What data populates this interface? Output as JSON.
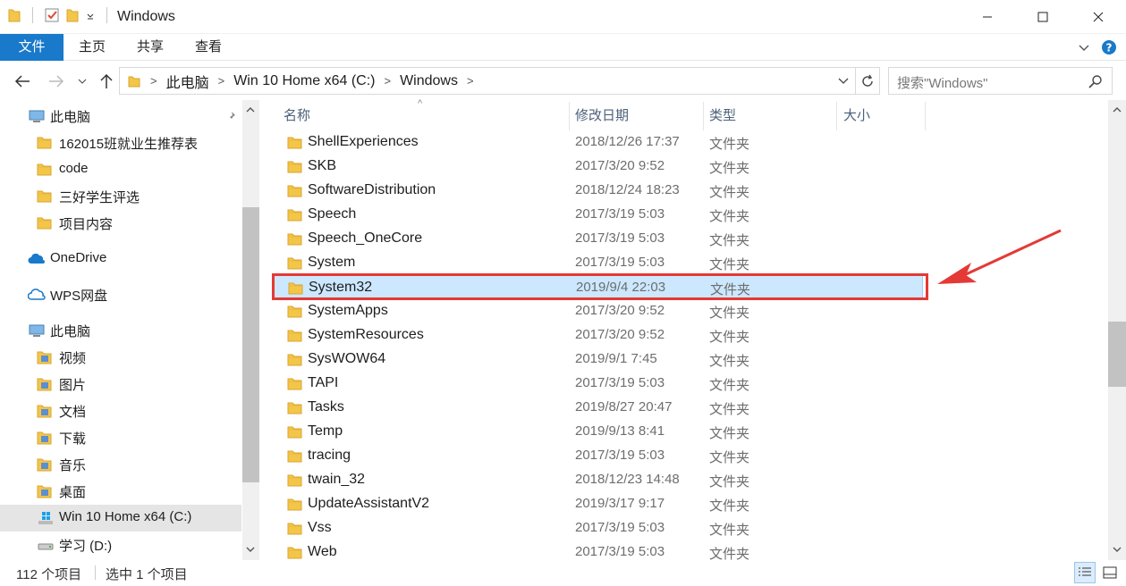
{
  "window": {
    "title": "Windows"
  },
  "ribbon": {
    "tabs": [
      "文件",
      "主页",
      "共享",
      "查看"
    ]
  },
  "address": {
    "crumbs": [
      "此电脑",
      "Win 10 Home x64 (C:)",
      "Windows"
    ]
  },
  "search": {
    "placeholder": "搜索\"Windows\""
  },
  "sidebar": {
    "items": [
      {
        "label": "此电脑",
        "icon": "pc-icon",
        "indent": 1,
        "pinned": true
      },
      {
        "label": "162015班就业生推荐表",
        "icon": "folder-icon",
        "indent": 2
      },
      {
        "label": "code",
        "icon": "folder-icon",
        "indent": 2
      },
      {
        "label": "三好学生评选",
        "icon": "folder-icon",
        "indent": 2
      },
      {
        "label": "项目内容",
        "icon": "folder-icon",
        "indent": 2
      },
      {
        "label": "OneDrive",
        "icon": "onedrive-icon",
        "indent": 1
      },
      {
        "label": "WPS网盘",
        "icon": "cloud-icon",
        "indent": 1
      },
      {
        "label": "此电脑",
        "icon": "pc-icon",
        "indent": 1
      },
      {
        "label": "视频",
        "icon": "video-folder-icon",
        "indent": 2
      },
      {
        "label": "图片",
        "icon": "pictures-folder-icon",
        "indent": 2
      },
      {
        "label": "文档",
        "icon": "documents-folder-icon",
        "indent": 2
      },
      {
        "label": "下载",
        "icon": "downloads-folder-icon",
        "indent": 2
      },
      {
        "label": "音乐",
        "icon": "music-folder-icon",
        "indent": 2
      },
      {
        "label": "桌面",
        "icon": "desktop-folder-icon",
        "indent": 2
      },
      {
        "label": "Win 10 Home x64 (C:)",
        "icon": "windows-drive-icon",
        "indent": 2,
        "selected": true
      },
      {
        "label": "学习 (D:)",
        "icon": "drive-icon",
        "indent": 2
      }
    ]
  },
  "columns": {
    "name": "名称",
    "date": "修改日期",
    "type": "类型",
    "size": "大小"
  },
  "files": [
    {
      "name": "ShellExperiences",
      "date": "2018/12/26 17:37",
      "type": "文件夹"
    },
    {
      "name": "SKB",
      "date": "2017/3/20 9:52",
      "type": "文件夹"
    },
    {
      "name": "SoftwareDistribution",
      "date": "2018/12/24 18:23",
      "type": "文件夹"
    },
    {
      "name": "Speech",
      "date": "2017/3/19 5:03",
      "type": "文件夹"
    },
    {
      "name": "Speech_OneCore",
      "date": "2017/3/19 5:03",
      "type": "文件夹"
    },
    {
      "name": "System",
      "date": "2017/3/19 5:03",
      "type": "文件夹"
    },
    {
      "name": "System32",
      "date": "2019/9/4 22:03",
      "type": "文件夹",
      "selected": true
    },
    {
      "name": "SystemApps",
      "date": "2017/3/20 9:52",
      "type": "文件夹"
    },
    {
      "name": "SystemResources",
      "date": "2017/3/20 9:52",
      "type": "文件夹"
    },
    {
      "name": "SysWOW64",
      "date": "2019/9/1 7:45",
      "type": "文件夹"
    },
    {
      "name": "TAPI",
      "date": "2017/3/19 5:03",
      "type": "文件夹"
    },
    {
      "name": "Tasks",
      "date": "2019/8/27 20:47",
      "type": "文件夹"
    },
    {
      "name": "Temp",
      "date": "2019/9/13 8:41",
      "type": "文件夹"
    },
    {
      "name": "tracing",
      "date": "2017/3/19 5:03",
      "type": "文件夹"
    },
    {
      "name": "twain_32",
      "date": "2018/12/23 14:48",
      "type": "文件夹"
    },
    {
      "name": "UpdateAssistantV2",
      "date": "2019/3/17 9:17",
      "type": "文件夹"
    },
    {
      "name": "Vss",
      "date": "2017/3/19 5:03",
      "type": "文件夹"
    },
    {
      "name": "Web",
      "date": "2017/3/19 5:03",
      "type": "文件夹"
    }
  ],
  "status": {
    "count": "112 个项目",
    "selection": "选中 1 个项目"
  },
  "colors": {
    "accent": "#1979ca",
    "selection": "#cce8ff",
    "annotation": "#e53935",
    "folder": "#f3c64a"
  }
}
